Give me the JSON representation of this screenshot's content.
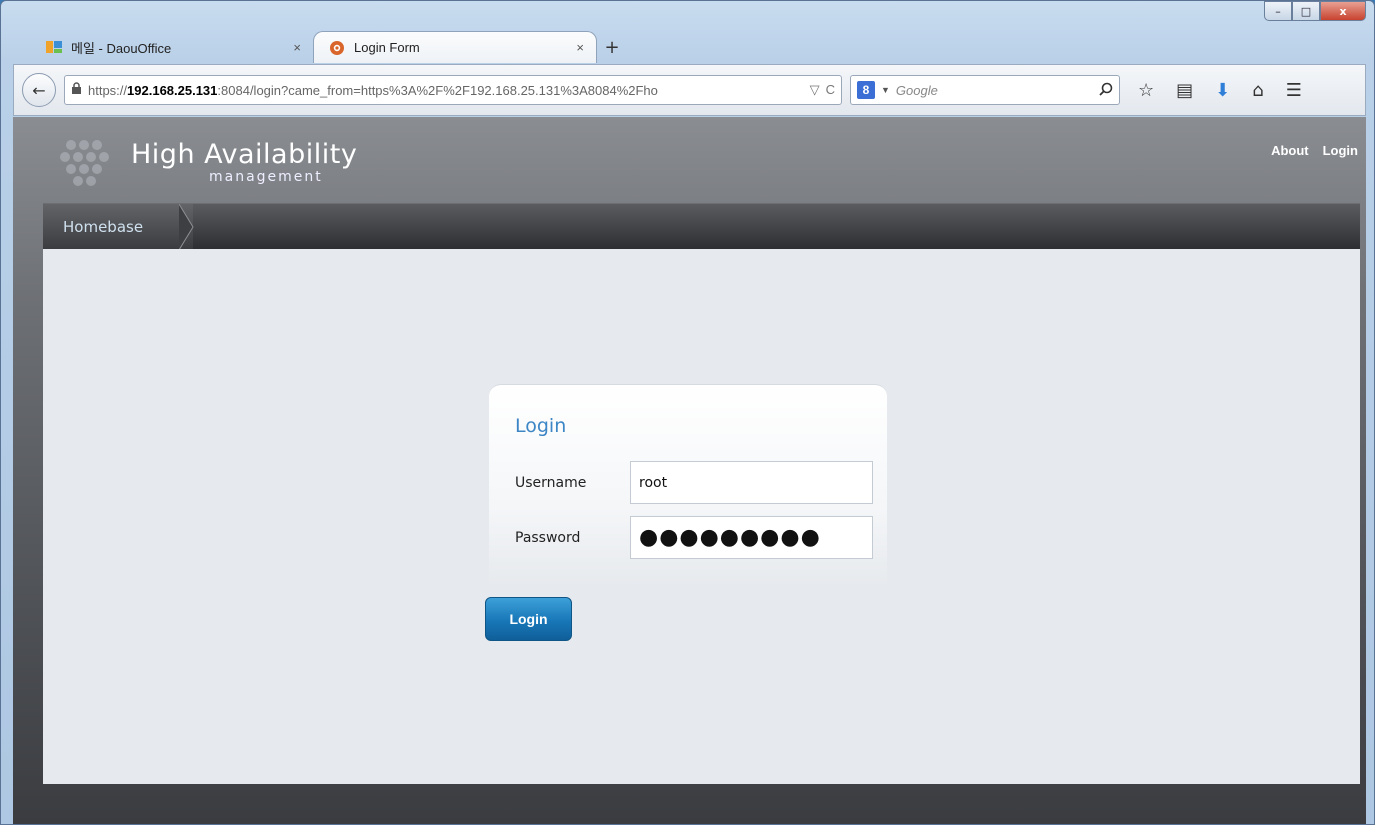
{
  "window": {
    "minimize": "–",
    "maximize": "□",
    "close": "x"
  },
  "tabs": [
    {
      "title": "메일 - DaouOffice",
      "close": "×",
      "icon": "daou-icon"
    },
    {
      "title": "Login Form",
      "close": "×",
      "icon": "gear-icon"
    }
  ],
  "new_tab": "+",
  "navbar": {
    "back": "←",
    "url_prefix": "https://",
    "url_host": "192.168.25.131",
    "url_rest": ":8084/login?came_from=https%3A%2F%2F192.168.25.131%3A8084%2Fho",
    "search_placeholder": "Google",
    "search_engine": "8"
  },
  "app": {
    "brand_title": "High Availability",
    "brand_subtitle": "management",
    "links": [
      "About",
      "Login"
    ],
    "breadcrumb": "Homebase"
  },
  "login": {
    "title": "Login",
    "username_label": "Username",
    "username_value": "root",
    "password_label": "Password",
    "password_value": "●●●●●●●●●",
    "button": "Login"
  },
  "colors": {
    "accent": "#3d86c6",
    "button": "#1877b8"
  }
}
